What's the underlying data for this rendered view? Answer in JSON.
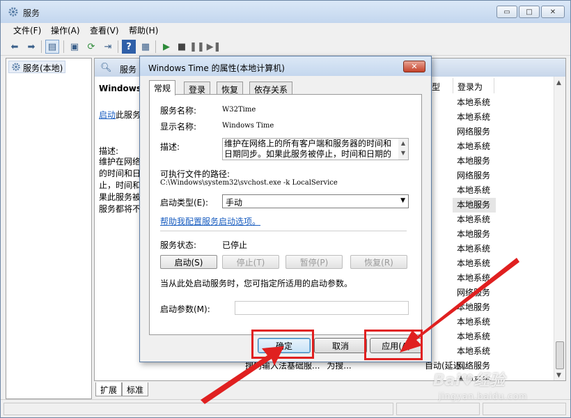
{
  "main_window": {
    "title": "服务",
    "min_glyph": "▭",
    "max_glyph": "□",
    "close_glyph": "✕"
  },
  "menu": [
    "文件(F)",
    "操作(A)",
    "查看(V)",
    "帮助(H)"
  ],
  "tree": {
    "item": "服务(本地)"
  },
  "services_pane": {
    "header": "服务",
    "selected_service_title": "Windows",
    "start_link": "启动",
    "start_suffix": "此服务",
    "desc_label": "描述:",
    "desc_lines": [
      "维护在网络",
      "的时间和日",
      "止，时间和",
      "果此服务被",
      "服务都将不"
    ],
    "col_type_fragment": "型",
    "col_login": "登录为",
    "login_values": [
      "本地系统",
      "本地系统",
      "网络服务",
      "本地系统",
      "本地服务",
      "网络服务",
      "本地系统",
      "本地服务",
      "本地系统",
      "本地服务",
      "本地系统",
      "本地系统",
      "本地系统",
      "网络服务",
      "本地服务",
      "本地系统",
      "本地系统",
      "本地系统",
      "网络服务",
      "本地系统"
    ],
    "row_bottom_name": "搜狗输入法基础服...",
    "row_bottom_desc": "为搜...",
    "row_bottom_start": "自动(延迟..."
  },
  "bottom_tabs": [
    "扩展",
    "标准"
  ],
  "dialog": {
    "title": "Windows Time 的属性(本地计算机)",
    "close_glyph": "✕",
    "tabs": [
      "常规",
      "登录",
      "恢复",
      "依存关系"
    ],
    "service_name_label": "服务名称:",
    "service_name": "W32Time",
    "display_name_label": "显示名称:",
    "display_name": "Windows Time",
    "description_label": "描述:",
    "description": "维护在网络上的所有客户端和服务器的时间和日期同步。如果此服务被停止，时间和日期的",
    "exe_path_label": "可执行文件的路径:",
    "exe_path": "C:\\Windows\\system32\\svchost.exe -k LocalService",
    "startup_type_label": "启动类型(E):",
    "startup_type": "手动",
    "help_link": "帮助我配置服务启动选项。",
    "status_label": "服务状态:",
    "status_value": "已停止",
    "btn_start": "启动(S)",
    "btn_stop": "停止(T)",
    "btn_pause": "暂停(P)",
    "btn_resume": "恢复(R)",
    "hint": "当从此处启动服务时，您可指定所适用的启动参数。",
    "params_label": "启动参数(M):",
    "params_value": "",
    "ok": "确定",
    "cancel": "取消",
    "apply": "应用(A)"
  },
  "annotation": {
    "color": "#e02020"
  },
  "watermark": {
    "main": "Bai♥经验",
    "sub": "jingyan.baidu.com"
  }
}
